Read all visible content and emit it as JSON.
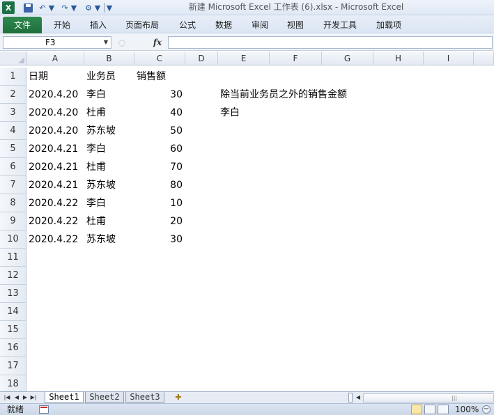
{
  "window": {
    "title": "新建 Microsoft Excel 工作表 (6).xlsx  -  Microsoft Excel",
    "app_logo": "X"
  },
  "quick_access": {
    "icons": [
      "excel-logo-icon",
      "save-icon",
      "undo-icon",
      "redo-icon",
      "tool-icon",
      "customize-dropdown-icon"
    ]
  },
  "ribbon": {
    "file_tab": "文件",
    "tabs": [
      "开始",
      "插入",
      "页面布局",
      "公式",
      "数据",
      "审阅",
      "视图",
      "开发工具",
      "加载项"
    ]
  },
  "formula_bar": {
    "name_box": "F3",
    "fx_label": "fx",
    "formula": ""
  },
  "sheet": {
    "columns": [
      "A",
      "B",
      "C",
      "D",
      "E",
      "F",
      "G",
      "H",
      "I"
    ],
    "rows": [
      "1",
      "2",
      "3",
      "4",
      "5",
      "6",
      "7",
      "8",
      "9",
      "10",
      "11",
      "12",
      "13",
      "14",
      "15",
      "16",
      "17",
      "18"
    ],
    "header_row": [
      "日期",
      "业务员",
      "销售额"
    ],
    "data": [
      {
        "date": "2020.4.20",
        "person": "李白",
        "amount": "30"
      },
      {
        "date": "2020.4.20",
        "person": "杜甫",
        "amount": "40"
      },
      {
        "date": "2020.4.20",
        "person": "苏东坡",
        "amount": "50"
      },
      {
        "date": "2020.4.21",
        "person": "李白",
        "amount": "60"
      },
      {
        "date": "2020.4.21",
        "person": "杜甫",
        "amount": "70"
      },
      {
        "date": "2020.4.21",
        "person": "苏东坡",
        "amount": "80"
      },
      {
        "date": "2020.4.22",
        "person": "李白",
        "amount": "10"
      },
      {
        "date": "2020.4.22",
        "person": "杜甫",
        "amount": "20"
      },
      {
        "date": "2020.4.22",
        "person": "苏东坡",
        "amount": "30"
      }
    ],
    "e2": "除当前业务员之外的销售金额",
    "e3": "李白"
  },
  "sheet_tabs": [
    "Sheet1",
    "Sheet2",
    "Sheet3"
  ],
  "active_sheet": "Sheet1",
  "status": {
    "mode": "就绪",
    "zoom": "100%",
    "zoom_out_label": "−"
  },
  "colors": {
    "file_tab": "#1e7145",
    "ribbon_bg": "#dfe8f5",
    "header_bg": "#e4eaf3"
  }
}
